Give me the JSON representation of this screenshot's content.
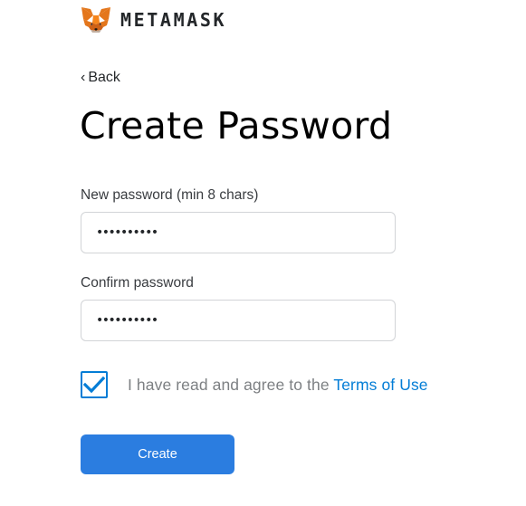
{
  "brand": {
    "name": "METAMASK",
    "logo_icon": "metamask-fox-icon"
  },
  "nav": {
    "back_label": "Back",
    "back_icon": "chevron-left-icon"
  },
  "page": {
    "title": "Create Password"
  },
  "form": {
    "new_password": {
      "label": "New password (min 8 chars)",
      "masked_value": "••••••••••"
    },
    "confirm_password": {
      "label": "Confirm password",
      "masked_value": "••••••••••"
    },
    "terms": {
      "checked": true,
      "text": "I have read and agree to the",
      "link": "Terms of Use"
    },
    "submit_label": "Create"
  },
  "colors": {
    "accent": "#037dd6",
    "button": "#2b7de0",
    "text": "#24272a",
    "muted": "#7d8083",
    "border": "#d2d4d7"
  }
}
